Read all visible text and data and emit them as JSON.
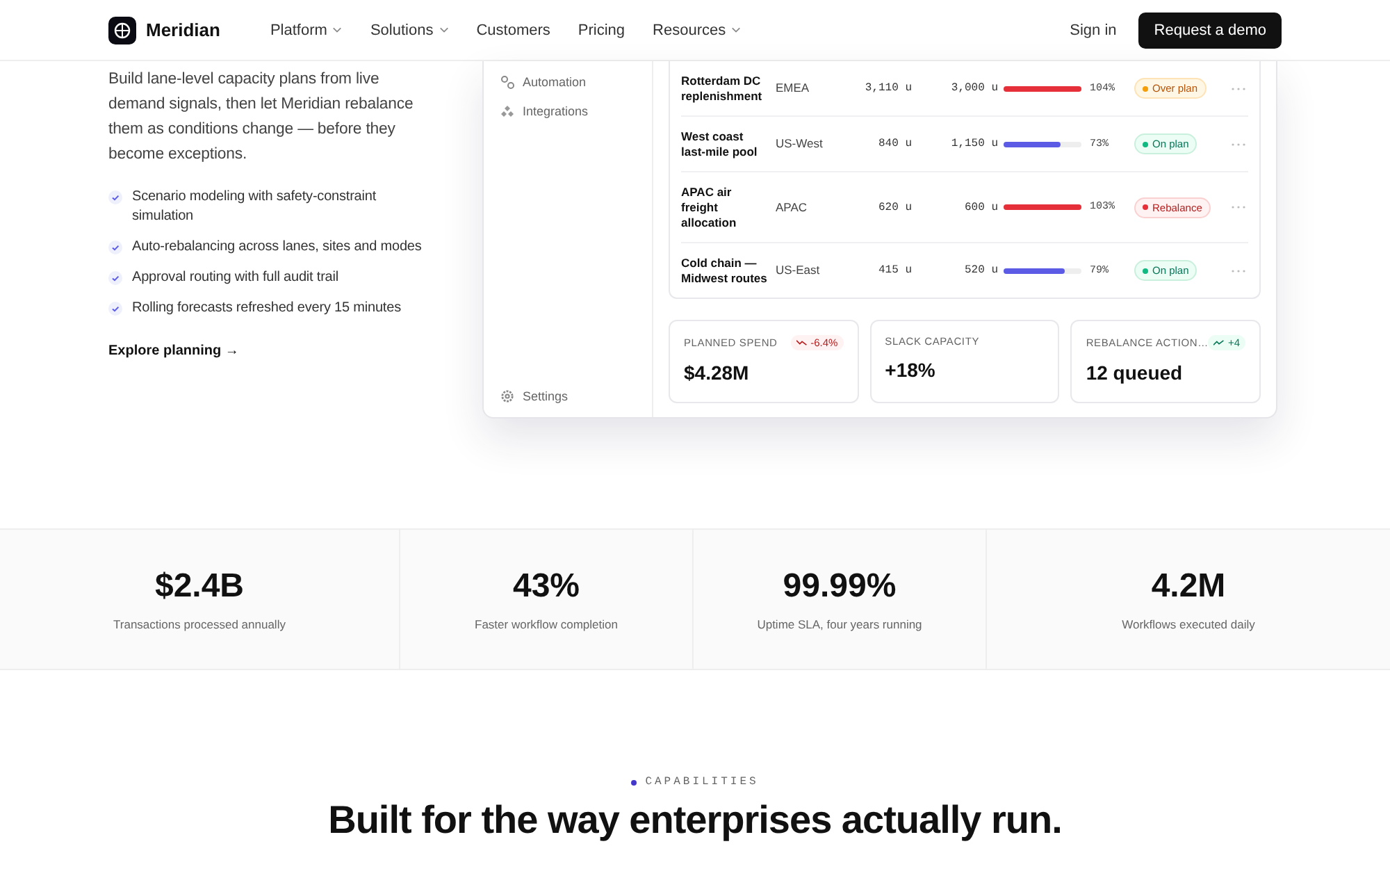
{
  "nav": {
    "brand": "Meridian",
    "links": [
      {
        "label": "Platform",
        "dropdown": true
      },
      {
        "label": "Solutions",
        "dropdown": true
      },
      {
        "label": "Customers",
        "dropdown": false
      },
      {
        "label": "Pricing",
        "dropdown": false
      },
      {
        "label": "Resources",
        "dropdown": true
      }
    ],
    "sign_in": "Sign in",
    "cta": "Request a demo"
  },
  "hero": {
    "paragraph": "Build lane-level capacity plans from live demand signals, then let Meridian rebalance them as conditions change — before they become exceptions.",
    "features": [
      "Scenario modeling with safety-constraint simulation",
      "Auto-rebalancing across lanes, sites and modes",
      "Approval routing with full audit trail",
      "Rolling forecasts refreshed every 15 minutes"
    ],
    "link": "Explore planning →"
  },
  "mockup": {
    "sidebar": [
      {
        "label": "Automation",
        "kind": "automation"
      },
      {
        "label": "Integrations",
        "kind": "integrations"
      }
    ],
    "settings": "Settings",
    "rows": [
      {
        "name": "Rotterdam DC replenishment",
        "region": "EMEA",
        "actual": "3,110 u",
        "plan": "3,000 u",
        "level": 1,
        "percent": "104%",
        "status": {
          "label": "Over plan",
          "kind": "over"
        }
      },
      {
        "name": "West coast last-mile pool",
        "region": "US-West",
        "actual": "840 u",
        "plan": "1,150 u",
        "level": 0.73,
        "percent": "73%",
        "status": {
          "label": "On plan",
          "kind": "on"
        }
      },
      {
        "name": "APAC air freight allocation",
        "region": "APAC",
        "actual": "620 u",
        "plan": "600 u",
        "level": 1,
        "percent": "103%",
        "status": {
          "label": "Rebalance",
          "kind": "rebalance"
        }
      },
      {
        "name": "Cold chain — Midwest routes",
        "region": "US-East",
        "actual": "415 u",
        "plan": "520 u",
        "level": 0.79,
        "percent": "79%",
        "status": {
          "label": "On plan",
          "kind": "on"
        }
      }
    ],
    "kpis": [
      {
        "label": "PLANNED SPEND",
        "value": "$4.28M",
        "delta": {
          "text": "-6.4%",
          "kind": "down"
        }
      },
      {
        "label": "SLACK CAPACITY",
        "value": "+18%"
      },
      {
        "label": "REBALANCE ACTION…",
        "value": "12 queued",
        "delta": {
          "text": "+4",
          "kind": "up"
        }
      }
    ]
  },
  "stats": [
    {
      "value": "$2.4B",
      "label": "Transactions processed annually"
    },
    {
      "value": "43%",
      "label": "Faster workflow completion"
    },
    {
      "value": "99.99%",
      "label": "Uptime SLA, four years running"
    },
    {
      "value": "4.2M",
      "label": "Workflows executed daily"
    }
  ],
  "capabilities": {
    "eyebrow": "CAPABILITIES",
    "heading": "Built for the way enterprises actually run."
  }
}
